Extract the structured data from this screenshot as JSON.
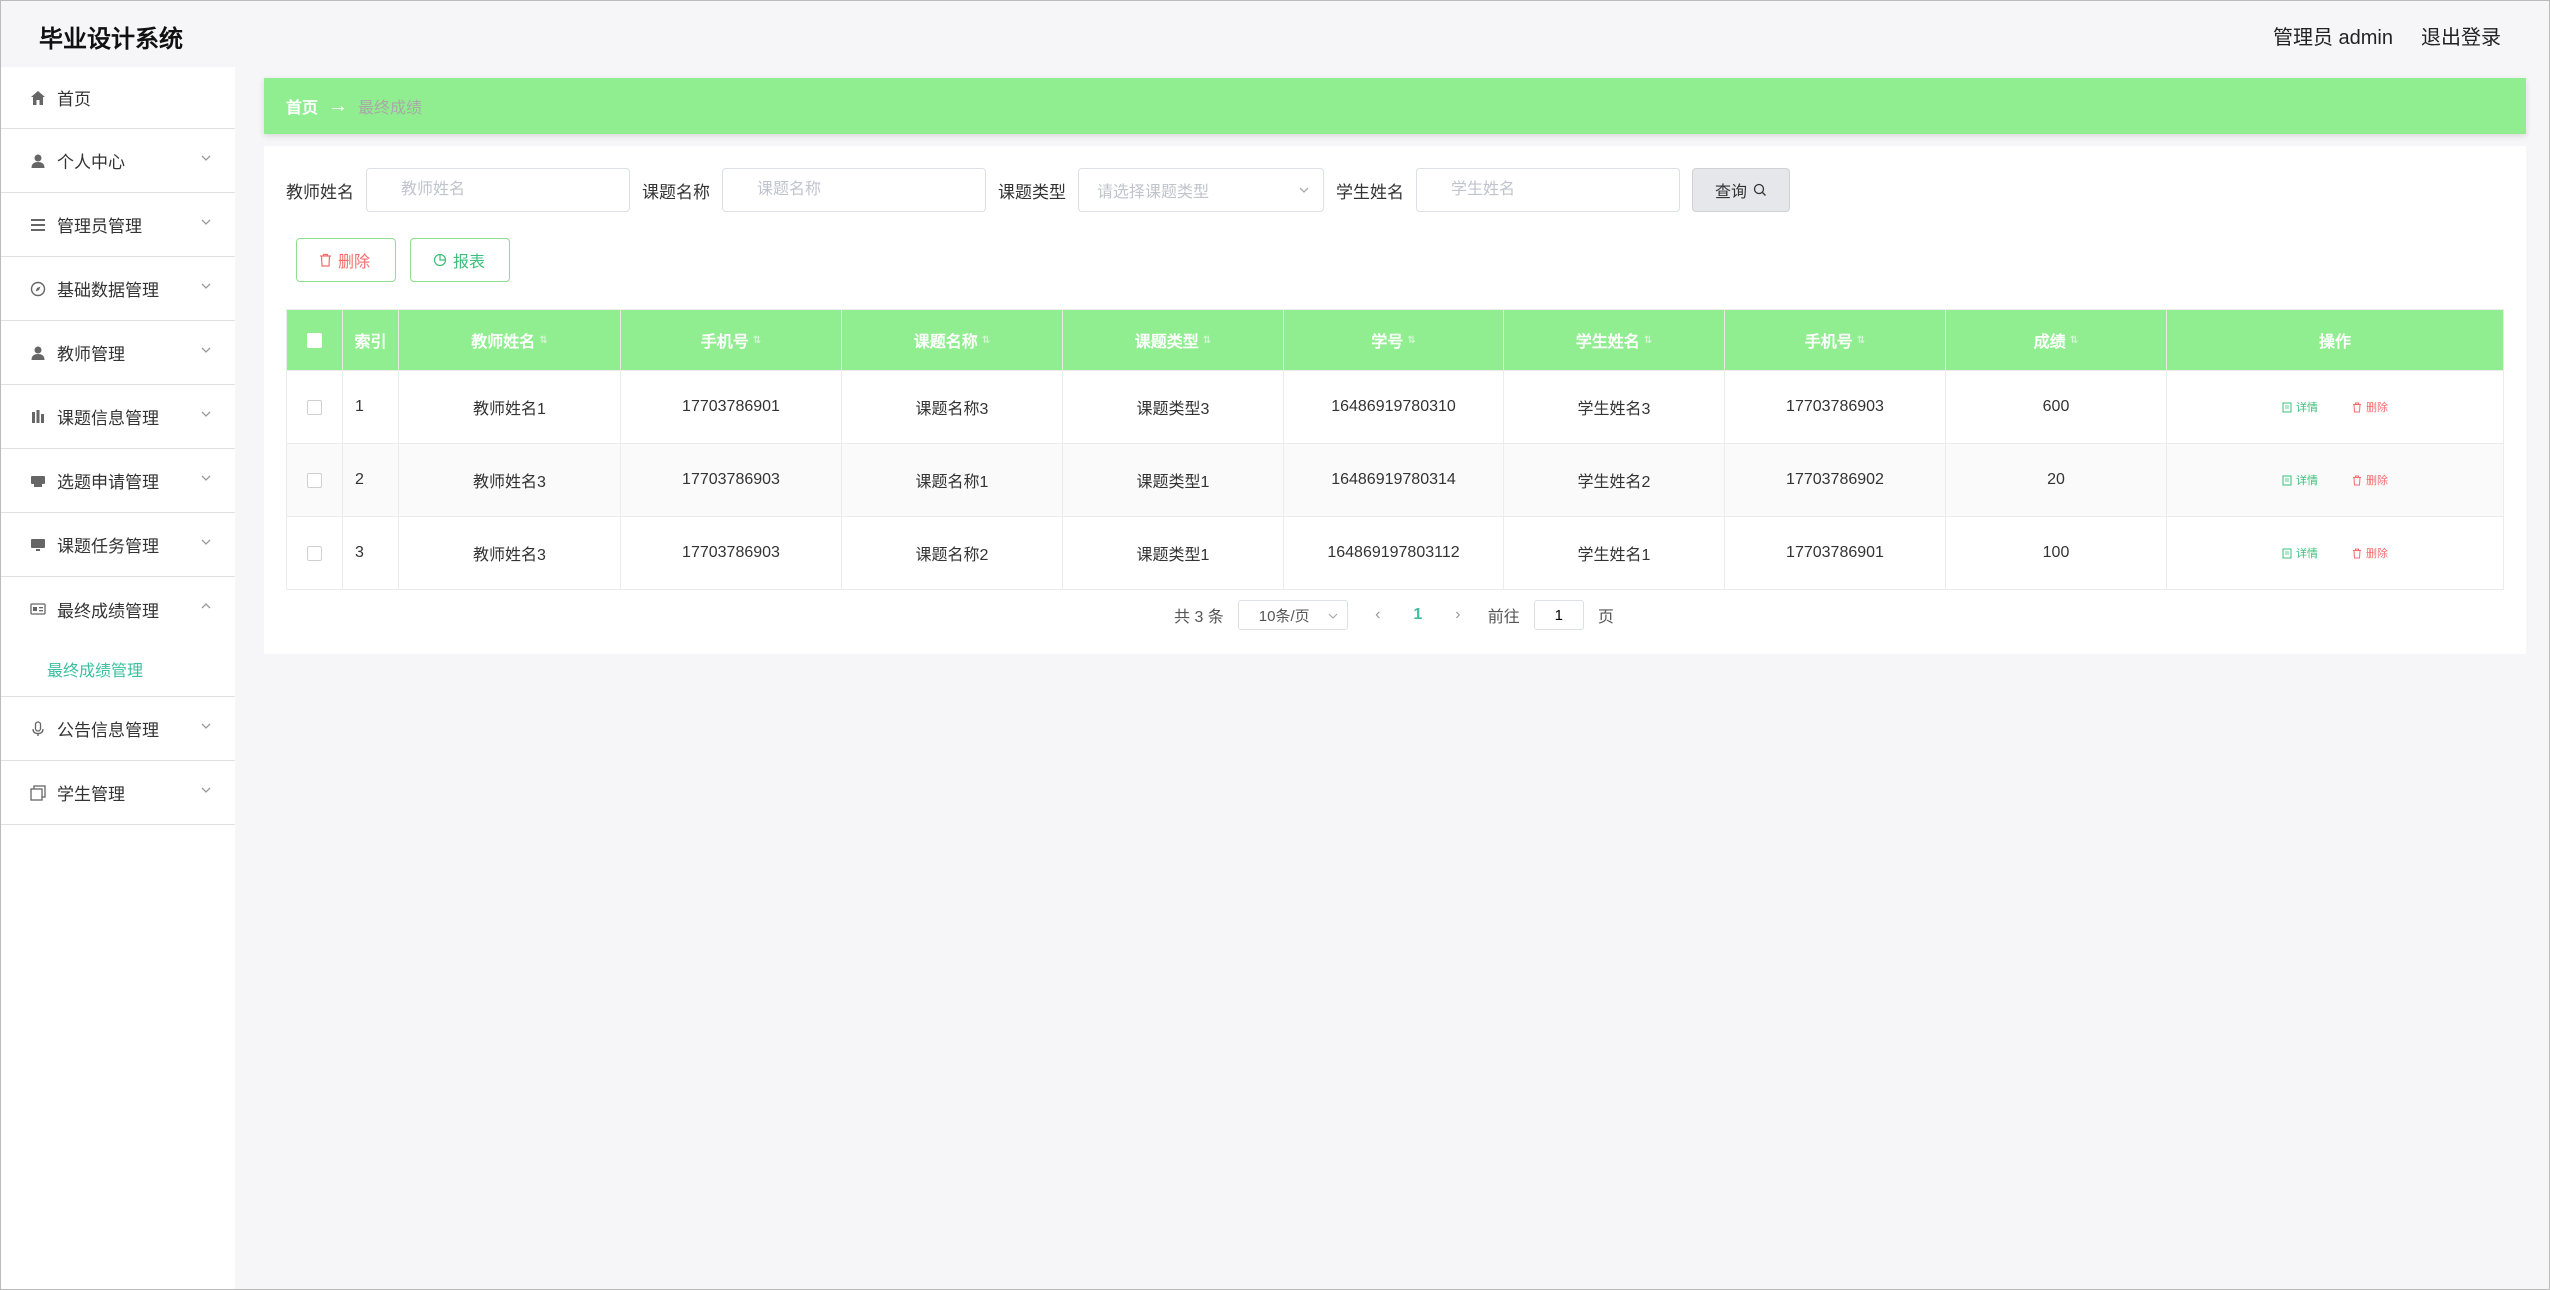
{
  "header": {
    "app_title": "毕业设计系统",
    "user_label": "管理员 admin",
    "logout_label": "退出登录"
  },
  "sidebar": {
    "items": [
      {
        "label": "首页",
        "icon": "home-icon"
      },
      {
        "label": "个人中心",
        "icon": "user-icon"
      },
      {
        "label": "管理员管理",
        "icon": "list-icon"
      },
      {
        "label": "基础数据管理",
        "icon": "compass-icon"
      },
      {
        "label": "教师管理",
        "icon": "user-icon"
      },
      {
        "label": "课题信息管理",
        "icon": "chart-icon"
      },
      {
        "label": "选题申请管理",
        "icon": "printer-icon"
      },
      {
        "label": "课题任务管理",
        "icon": "monitor-icon"
      },
      {
        "label": "最终成绩管理",
        "icon": "card-icon"
      },
      {
        "label": "公告信息管理",
        "icon": "microphone-icon"
      },
      {
        "label": "学生管理",
        "icon": "copy-icon"
      }
    ],
    "active_submenu": "最终成绩管理"
  },
  "breadcrumb": {
    "home": "首页",
    "arrow": "→",
    "current": "最终成绩"
  },
  "search": {
    "teacher_label": "教师姓名",
    "teacher_placeholder": "教师姓名",
    "topic_label": "课题名称",
    "topic_placeholder": "课题名称",
    "type_label": "课题类型",
    "type_placeholder": "请选择课题类型",
    "student_label": "学生姓名",
    "student_placeholder": "学生姓名",
    "query_label": "查询"
  },
  "actions": {
    "delete_label": "删除",
    "report_label": "报表"
  },
  "table": {
    "headers": [
      "索引",
      "教师姓名",
      "手机号",
      "课题名称",
      "课题类型",
      "学号",
      "学生姓名",
      "手机号",
      "成绩",
      "操作"
    ],
    "rows": [
      {
        "index": "1",
        "teacher": "教师姓名1",
        "teacher_phone": "17703786901",
        "topic": "课题名称3",
        "type": "课题类型3",
        "student_no": "16486919780310",
        "student": "学生姓名3",
        "student_phone": "17703786903",
        "score": "600"
      },
      {
        "index": "2",
        "teacher": "教师姓名3",
        "teacher_phone": "17703786903",
        "topic": "课题名称1",
        "type": "课题类型1",
        "student_no": "16486919780314",
        "student": "学生姓名2",
        "student_phone": "17703786902",
        "score": "20"
      },
      {
        "index": "3",
        "teacher": "教师姓名3",
        "teacher_phone": "17703786903",
        "topic": "课题名称2",
        "type": "课题类型1",
        "student_no": "164869197803112",
        "student": "学生姓名1",
        "student_phone": "17703786901",
        "score": "100"
      }
    ],
    "detail_label": "详情",
    "delete_label": "删除"
  },
  "pagination": {
    "total": "共 3 条",
    "page_size": "10条/页",
    "current_page": "1",
    "goto_label": "前往",
    "goto_value": "1",
    "page_suffix": "页"
  },
  "colors": {
    "accent_green": "#90ee90",
    "active_text": "#3cbfa0",
    "danger": "#f56c6c"
  }
}
